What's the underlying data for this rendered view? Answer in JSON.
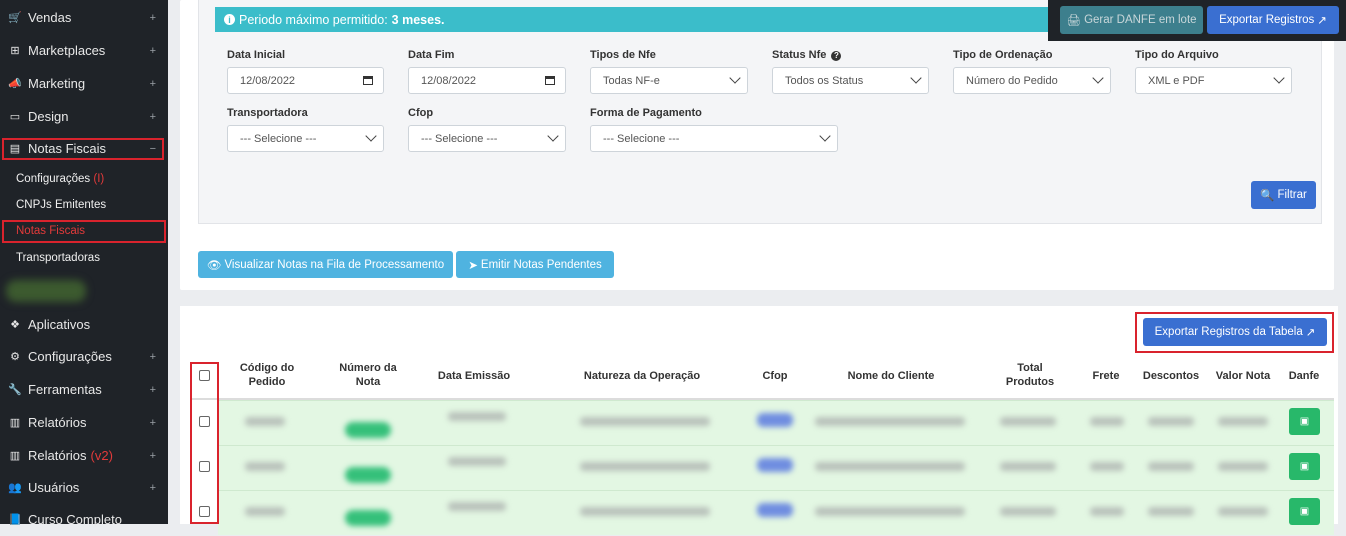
{
  "sidebar": {
    "items": [
      {
        "label": "Vendas",
        "icon": "cart-icon"
      },
      {
        "label": "Marketplaces",
        "icon": "sitemap-icon"
      },
      {
        "label": "Marketing",
        "icon": "megaphone-icon"
      },
      {
        "label": "Design",
        "icon": "laptop-icon"
      },
      {
        "label": "Notas Fiscais",
        "icon": "invoice-icon"
      },
      {
        "label": "Aplicativos",
        "icon": "cubes-icon"
      },
      {
        "label": "Configurações",
        "icon": "gears-icon"
      },
      {
        "label": "Ferramentas",
        "icon": "wrench-icon"
      },
      {
        "label": "Relatórios",
        "icon": "chart-icon"
      },
      {
        "label": "Relatórios",
        "icon": "chart-icon",
        "badge": "(v2)"
      },
      {
        "label": "Usuários",
        "icon": "users-icon"
      },
      {
        "label": "Curso Completo",
        "icon": "book-icon"
      }
    ],
    "sub": {
      "configuracoes": "Configurações",
      "configuracoes_badge": "(I)",
      "cnpjs": "CNPJs Emitentes",
      "notas": "Notas Fiscais",
      "transportadoras": "Transportadoras"
    },
    "plus": "+",
    "minus": "−"
  },
  "alert": {
    "text": "Periodo máximo permitido:",
    "bold": "3 meses."
  },
  "toolbar": {
    "gerar_danfe": "Gerar DANFE em lote",
    "exportar": "Exportar Registros"
  },
  "filters": {
    "data_inicial": {
      "label": "Data Inicial",
      "value": "12/08/2022"
    },
    "data_fim": {
      "label": "Data Fim",
      "value": "12/08/2022"
    },
    "tipos_nfe": {
      "label": "Tipos de Nfe",
      "value": "Todas NF-e"
    },
    "status_nfe": {
      "label": "Status Nfe",
      "value": "Todos os Status"
    },
    "tipo_ordenacao": {
      "label": "Tipo de Ordenação",
      "value": "Número do Pedido"
    },
    "tipo_arquivo": {
      "label": "Tipo do Arquivo",
      "value": "XML e PDF"
    },
    "transportadora": {
      "label": "Transportadora",
      "value": "--- Selecione ---"
    },
    "cfop": {
      "label": "Cfop",
      "value": "--- Selecione ---"
    },
    "forma_pagamento": {
      "label": "Forma de Pagamento",
      "value": "--- Selecione ---"
    },
    "filtrar": "Filtrar"
  },
  "actions": {
    "visualizar": "Visualizar Notas na Fila de Processamento",
    "emitir": "Emitir Notas Pendentes"
  },
  "table": {
    "export_label": "Exportar Registros da Tabela",
    "headers": {
      "codigo_1": "Código do",
      "codigo_2": "Pedido",
      "numero_1": "Número da",
      "numero_2": "Nota",
      "emissao": "Data Emissão",
      "natureza": "Natureza da Operação",
      "cfop": "Cfop",
      "cliente": "Nome do Cliente",
      "total_1": "Total",
      "total_2": "Produtos",
      "frete": "Frete",
      "descontos": "Descontos",
      "valor": "Valor Nota",
      "danfe": "Danfe"
    }
  },
  "colors": {
    "sidebar": "#1f2328",
    "primary": "#3a6fd1",
    "info": "#3bbdca",
    "success": "#28b86a",
    "highlight": "#d9232d"
  }
}
